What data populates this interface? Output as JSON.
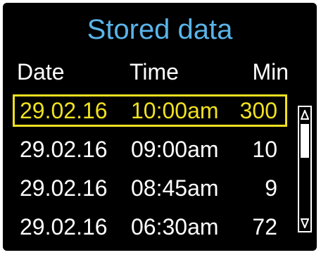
{
  "screen": {
    "title": "Stored data",
    "title_color": "#5ab4e8",
    "highlight_color": "#f0e020"
  },
  "columns": {
    "date": "Date",
    "time": "Time",
    "min": "Min"
  },
  "rows": [
    {
      "date": "29.02.16",
      "time": "10:00am",
      "min": "300",
      "selected": true
    },
    {
      "date": "29.02.16",
      "time": "09:00am",
      "min": "10",
      "selected": false
    },
    {
      "date": "29.02.16",
      "time": "08:45am",
      "min": "9",
      "selected": false
    },
    {
      "date": "29.02.16",
      "time": "06:30am",
      "min": "72",
      "selected": false
    }
  ],
  "scrollbar": {
    "up_icon": "triangle-up-icon",
    "down_icon": "triangle-down-icon",
    "position": 0
  }
}
